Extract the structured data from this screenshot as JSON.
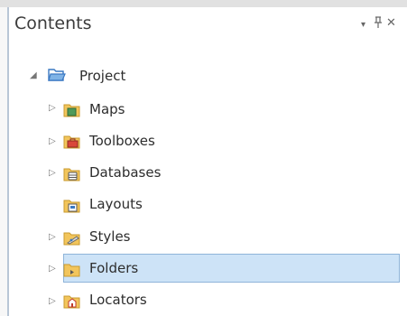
{
  "pane": {
    "title": "Contents",
    "dropdown_glyph": "▾",
    "pin_glyph": "ꟽ",
    "close_glyph": "✕"
  },
  "tree": {
    "root": {
      "label": "Project",
      "expanded_glyph": "◢",
      "icon": "open-folder-icon"
    },
    "items": [
      {
        "label": "Maps",
        "icon": "maps-folder-icon",
        "expander": "▷"
      },
      {
        "label": "Toolboxes",
        "icon": "toolboxes-folder-icon",
        "expander": "▷"
      },
      {
        "label": "Databases",
        "icon": "databases-folder-icon",
        "expander": "▷"
      },
      {
        "label": "Layouts",
        "icon": "layouts-folder-icon",
        "expander": ""
      },
      {
        "label": "Styles",
        "icon": "styles-folder-icon",
        "expander": "▷"
      },
      {
        "label": "Folders",
        "icon": "folders-folder-icon",
        "expander": "▷",
        "selected": true
      },
      {
        "label": "Locators",
        "icon": "locators-folder-icon",
        "expander": "▷"
      }
    ]
  },
  "colors": {
    "selection_fill": "#cde3f7",
    "selection_border": "#8fb4d9",
    "folder_yellow": "#f2c55c"
  }
}
